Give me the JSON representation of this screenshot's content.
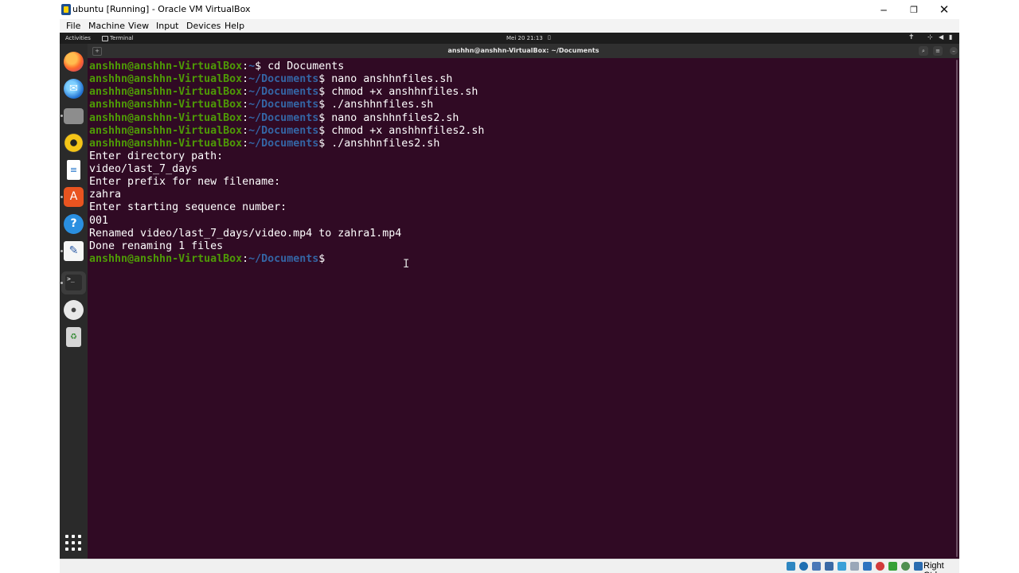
{
  "window": {
    "title": "ubuntu [Running] - Oracle VM VirtualBox",
    "controls": {
      "minimize": "─",
      "maximize": "❐",
      "close": "✕"
    }
  },
  "vb_menu": {
    "file": "File",
    "machine": "Machine",
    "view": "View",
    "input": "Input",
    "devices": "Devices",
    "help": "Help"
  },
  "ubuntu_topbar": {
    "activities": "Activities",
    "app_name": "Terminal",
    "clock": "Mei 20  21:13",
    "notification_icon": "bell-icon",
    "status_icons": [
      "accessibility-icon",
      "network-icon",
      "volume-icon",
      "power-icon"
    ]
  },
  "dock": {
    "items": [
      {
        "name": "Firefox",
        "icon": "firefox-icon"
      },
      {
        "name": "Thunderbird Mail",
        "icon": "thunderbird-icon"
      },
      {
        "name": "Files",
        "icon": "files-icon"
      },
      {
        "name": "Rhythmbox",
        "icon": "rhythmbox-icon"
      },
      {
        "name": "LibreOffice Writer",
        "icon": "writer-icon"
      },
      {
        "name": "Ubuntu Software",
        "icon": "software-icon"
      },
      {
        "name": "Help",
        "icon": "help-icon"
      },
      {
        "name": "Text Editor",
        "icon": "text-editor-icon"
      },
      {
        "name": "Terminal",
        "icon": "terminal-icon"
      },
      {
        "name": "Disc",
        "icon": "disc-icon"
      },
      {
        "name": "Trash",
        "icon": "trash-icon"
      }
    ],
    "show_apps_icon": "grid-icon",
    "running_indicator_color": "#bbbbbb"
  },
  "terminal": {
    "title": "anshhn@anshhn-VirtualBox: ~/Documents",
    "colors": {
      "background": "#300a24",
      "prompt_user": "#4e9a06",
      "prompt_path": "#3465a4",
      "text": "#ffffff"
    },
    "lines": [
      {
        "user": "anshhn@anshhn-VirtualBox",
        "sep": ":",
        "path": "~",
        "cmd": "$ cd Documents"
      },
      {
        "user": "anshhn@anshhn-VirtualBox",
        "sep": ":",
        "path": "~/Documents",
        "cmd": "$ nano anshhnfiles.sh"
      },
      {
        "user": "anshhn@anshhn-VirtualBox",
        "sep": ":",
        "path": "~/Documents",
        "cmd": "$ chmod +x anshhnfiles.sh"
      },
      {
        "user": "anshhn@anshhn-VirtualBox",
        "sep": ":",
        "path": "~/Documents",
        "cmd": "$ ./anshhnfiles.sh"
      },
      {
        "user": "anshhn@anshhn-VirtualBox",
        "sep": ":",
        "path": "~/Documents",
        "cmd": "$ nano anshhnfiles2.sh"
      },
      {
        "user": "anshhn@anshhn-VirtualBox",
        "sep": ":",
        "path": "~/Documents",
        "cmd": "$ chmod +x anshhnfiles2.sh"
      },
      {
        "user": "anshhn@anshhn-VirtualBox",
        "sep": ":",
        "path": "~/Documents",
        "cmd": "$ ./anshhnfiles2.sh"
      },
      {
        "text": "Enter directory path:"
      },
      {
        "text": "video/last_7_days"
      },
      {
        "text": "Enter prefix for new filename:"
      },
      {
        "text": "zahra"
      },
      {
        "text": "Enter starting sequence number:"
      },
      {
        "text": "001"
      },
      {
        "text": "Renamed video/last_7_days/video.mp4 to zahra1.mp4"
      },
      {
        "text": "Done renaming 1 files"
      },
      {
        "user": "anshhn@anshhn-VirtualBox",
        "sep": ":",
        "path": "~/Documents",
        "cmd": "$ "
      }
    ]
  },
  "statusbar": {
    "icons": [
      "optical-drive-icon",
      "audio-icon",
      "network-icon",
      "usb-icon",
      "shared-folders-icon",
      "clipboard-icon",
      "display-icon",
      "recording-icon",
      "vtx-icon",
      "mouse-integration-icon",
      "keyboard-icon"
    ],
    "host_key": "Right Ctrl"
  }
}
